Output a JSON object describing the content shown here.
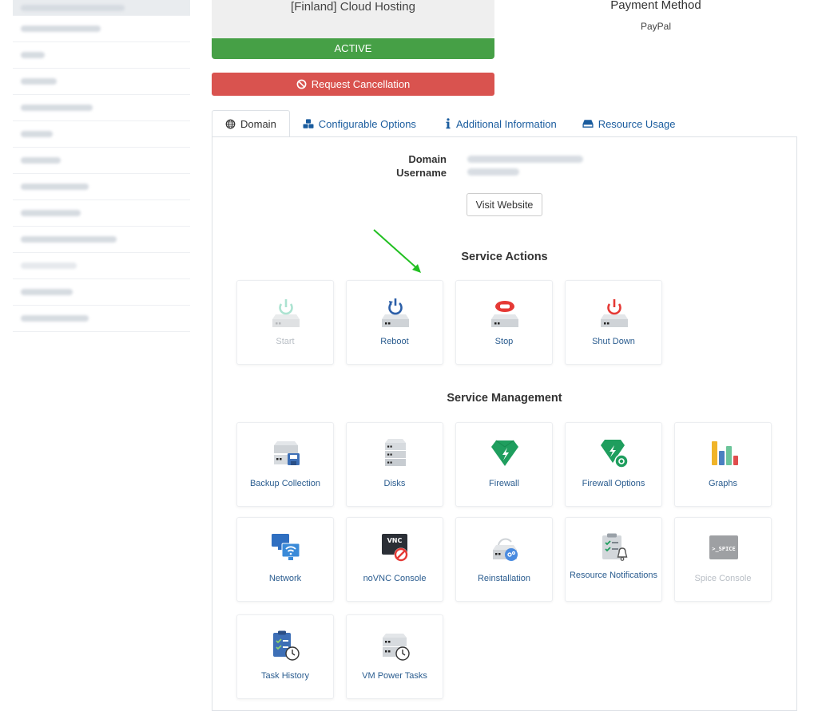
{
  "product": {
    "name": "[Finland] Cloud Hosting",
    "status": "ACTIVE"
  },
  "cancel_label": "Request Cancellation",
  "payment": {
    "title": "Payment Method",
    "value": "PayPal"
  },
  "tabs": [
    {
      "label": "Domain",
      "icon": "globe-icon"
    },
    {
      "label": "Configurable Options",
      "icon": "cubes-icon"
    },
    {
      "label": "Additional Information",
      "icon": "info-icon"
    },
    {
      "label": "Resource Usage",
      "icon": "hdd-icon"
    }
  ],
  "domain_info": {
    "domain_label": "Domain",
    "username_label": "Username"
  },
  "visit_label": "Visit Website",
  "service_actions": {
    "title": "Service Actions",
    "items": [
      {
        "label": "Start",
        "icon": "server-power-icon",
        "enabled": false
      },
      {
        "label": "Reboot",
        "icon": "server-reboot-icon",
        "enabled": true
      },
      {
        "label": "Stop",
        "icon": "server-stop-icon",
        "enabled": true
      },
      {
        "label": "Shut Down",
        "icon": "server-shutdown-icon",
        "enabled": true
      }
    ]
  },
  "service_management": {
    "title": "Service Management",
    "items": [
      {
        "label": "Backup Collection",
        "icon": "backup-icon"
      },
      {
        "label": "Disks",
        "icon": "disks-icon"
      },
      {
        "label": "Firewall",
        "icon": "firewall-icon"
      },
      {
        "label": "Firewall Options",
        "icon": "firewall-options-icon"
      },
      {
        "label": "Graphs",
        "icon": "graphs-icon"
      },
      {
        "label": "Network",
        "icon": "network-icon"
      },
      {
        "label": "noVNC Console",
        "icon": "vnc-console-icon"
      },
      {
        "label": "Reinstallation",
        "icon": "reinstall-icon"
      },
      {
        "label": "Resource Notifications",
        "icon": "resource-notifications-icon"
      },
      {
        "label": "Spice Console",
        "icon": "spice-console-icon",
        "enabled": false
      },
      {
        "label": "Task History",
        "icon": "task-history-icon"
      },
      {
        "label": "VM Power Tasks",
        "icon": "vm-power-tasks-icon"
      }
    ]
  },
  "icon_texts": {
    "vnc": "VNC",
    "spice": ">_SPICE"
  },
  "colors": {
    "active": "#46a046",
    "danger": "#d9534f",
    "link": "#1a5c9e",
    "arrow": "#22c022"
  }
}
